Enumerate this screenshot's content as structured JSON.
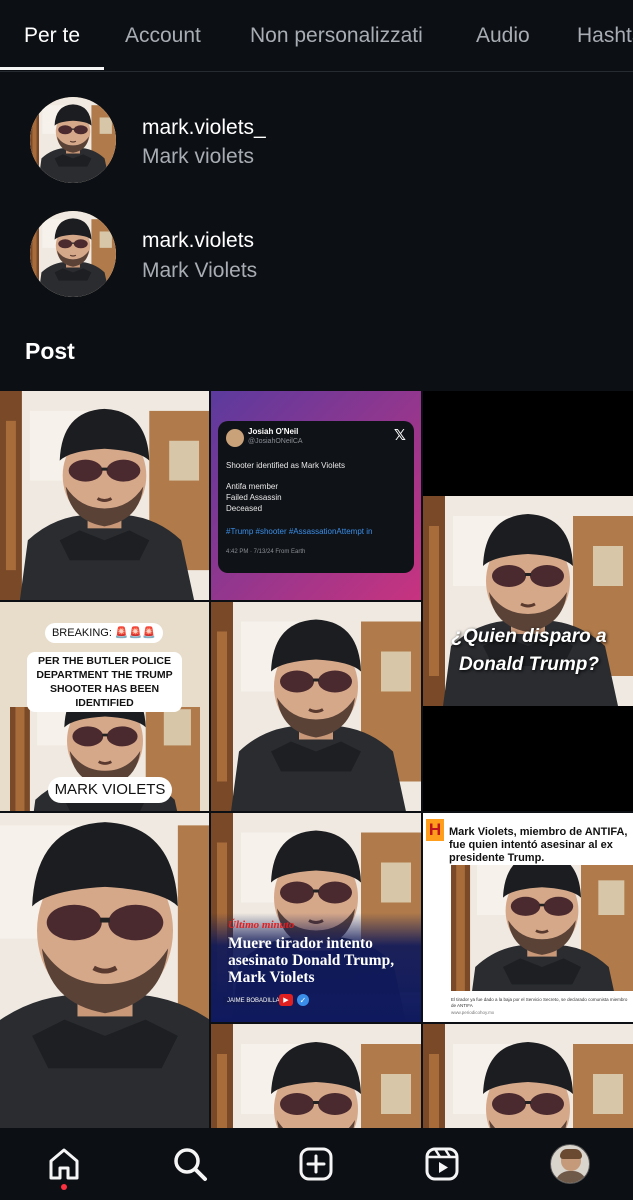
{
  "tabs": [
    {
      "label": "Per te"
    },
    {
      "label": "Account"
    },
    {
      "label": "Non personalizzati"
    },
    {
      "label": "Audio"
    },
    {
      "label": "Hashtag"
    }
  ],
  "accounts": [
    {
      "username": "mark.violets_",
      "fullname": "Mark violets"
    },
    {
      "username": "mark.violets",
      "fullname": "Mark Violets"
    }
  ],
  "section_title": "Post",
  "posts": {
    "tweet": {
      "name": "Josiah O'Neil",
      "handle": "@JosiahONeilCA",
      "line1": "Shooter identified as Mark Violets",
      "line2": "Antifa member",
      "line3": "Failed Assassin",
      "line4": "Deceased",
      "hashtags": "#Trump #shooter #AssassationAttempt in",
      "meta": "4:42 PM · 7/13/24 From Earth"
    },
    "question": "¿Quien disparo a Donald Trump?",
    "breaking": {
      "label": "BREAKING: 🚨🚨🚨",
      "text": "PER THE BUTLER POLICE DEPARTMENT THE TRUMP SHOOTER HAS BEEN IDENTIFIED",
      "name": "MARK VIOLETS"
    },
    "news": {
      "badge": "Último minuto",
      "headline": "Muere tirador intento asesinato Donald Trump, Mark Violets",
      "author": "JAIME BOBADILLA"
    },
    "article": {
      "logo": "H",
      "headline": "Mark Violets, miembro de ANTIFA, fue quien intentó asesinar al ex presidente Trump.",
      "caption": "El tirador ya fue dado a la baja por el Servicio Secreto, se declarado comunista miembro de ANTIFA",
      "url": "www.periodicohoy.mx"
    }
  },
  "nav": [
    {
      "icon": "home-icon"
    },
    {
      "icon": "search-icon"
    },
    {
      "icon": "create-icon"
    },
    {
      "icon": "reels-icon"
    },
    {
      "icon": "profile-avatar"
    }
  ],
  "colors": {
    "background": "#0c0f14",
    "notification_dot": "#ff3040",
    "tweet_gradient_start": "#5b3a9e",
    "tweet_gradient_end": "#c8337f"
  }
}
